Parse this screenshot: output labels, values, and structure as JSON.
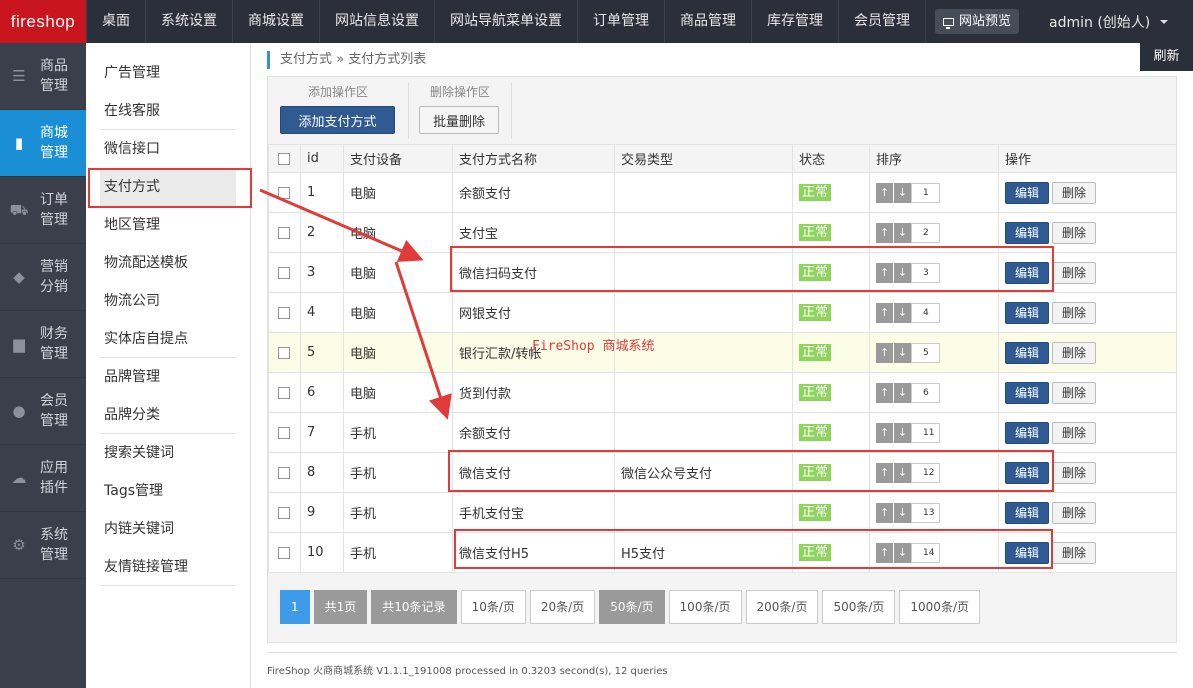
{
  "logo": "fireshop",
  "topnav": [
    "桌面",
    "系统设置",
    "商城设置",
    "网站信息设置",
    "网站导航菜单设置",
    "订单管理",
    "商品管理",
    "库存管理",
    "会员管理"
  ],
  "preview_label": "网站预览",
  "admin_label": "admin (创始人)",
  "leftbar": [
    {
      "label1": "商品",
      "label2": "管理",
      "icon": "list-icon"
    },
    {
      "label1": "商城",
      "label2": "管理",
      "icon": "book-icon"
    },
    {
      "label1": "订单",
      "label2": "管理",
      "icon": "cart-icon"
    },
    {
      "label1": "营销",
      "label2": "分销",
      "icon": "tag-icon"
    },
    {
      "label1": "财务",
      "label2": "管理",
      "icon": "bar-chart-icon"
    },
    {
      "label1": "会员",
      "label2": "管理",
      "icon": "user-icon"
    },
    {
      "label1": "应用",
      "label2": "插件",
      "icon": "cloud-icon"
    },
    {
      "label1": "系统",
      "label2": "管理",
      "icon": "gear-icon"
    }
  ],
  "submenu": [
    "广告管理",
    "在线客服",
    "微信接口",
    "支付方式",
    "地区管理",
    "物流配送模板",
    "物流公司",
    "实体店自提点",
    "品牌管理",
    "品牌分类",
    "搜索关键词",
    "Tags管理",
    "内链关键词",
    "友情链接管理"
  ],
  "breadcrumb": "支付方式 » 支付方式列表",
  "refresh_label": "刷新",
  "toolbar": {
    "add_zone_label": "添加操作区",
    "delete_zone_label": "删除操作区",
    "add_button": "添加支付方式",
    "batch_delete_button": "批量删除"
  },
  "table": {
    "headers": [
      "id",
      "支付设备",
      "支付方式名称",
      "交易类型",
      "状态",
      "排序",
      "操作"
    ],
    "edit_label": "编辑",
    "delete_label": "删除",
    "rows": [
      {
        "id": "1",
        "device": "电脑",
        "name": "余额支付",
        "trade": "",
        "status": "正常",
        "sort": "1"
      },
      {
        "id": "2",
        "device": "电脑",
        "name": "支付宝",
        "trade": "",
        "status": "正常",
        "sort": "2"
      },
      {
        "id": "3",
        "device": "电脑",
        "name": "微信扫码支付",
        "trade": "",
        "status": "正常",
        "sort": "3"
      },
      {
        "id": "4",
        "device": "电脑",
        "name": "网银支付",
        "trade": "",
        "status": "正常",
        "sort": "4"
      },
      {
        "id": "5",
        "device": "电脑",
        "name": "银行汇款/转帐",
        "trade": "",
        "status": "正常",
        "sort": "5"
      },
      {
        "id": "6",
        "device": "电脑",
        "name": "货到付款",
        "trade": "",
        "status": "正常",
        "sort": "6"
      },
      {
        "id": "7",
        "device": "手机",
        "name": "余额支付",
        "trade": "",
        "status": "正常",
        "sort": "11"
      },
      {
        "id": "8",
        "device": "手机",
        "name": "微信支付",
        "trade": "微信公众号支付",
        "status": "正常",
        "sort": "12"
      },
      {
        "id": "9",
        "device": "手机",
        "name": "手机支付宝",
        "trade": "",
        "status": "正常",
        "sort": "13"
      },
      {
        "id": "10",
        "device": "手机",
        "name": "微信支付H5",
        "trade": "H5支付",
        "status": "正常",
        "sort": "14"
      }
    ]
  },
  "pager": {
    "current": "1",
    "total_pages": "共1页",
    "total_records": "共10条记录",
    "sizes": [
      "10条/页",
      "20条/页",
      "50条/页",
      "100条/页",
      "200条/页",
      "500条/页",
      "1000条/页"
    ],
    "selected_size": "50条/页"
  },
  "footer": "FireShop 火商商城系统 V1.1.1_191008 processed in 0.3203 second(s), 12 queries",
  "watermark": "FireShop 商城系统",
  "colors": {
    "accent_red": "#e03a3a",
    "brand_red": "#c9151e",
    "primary_blue": "#2f5a92",
    "status_green": "#8ed55b"
  }
}
